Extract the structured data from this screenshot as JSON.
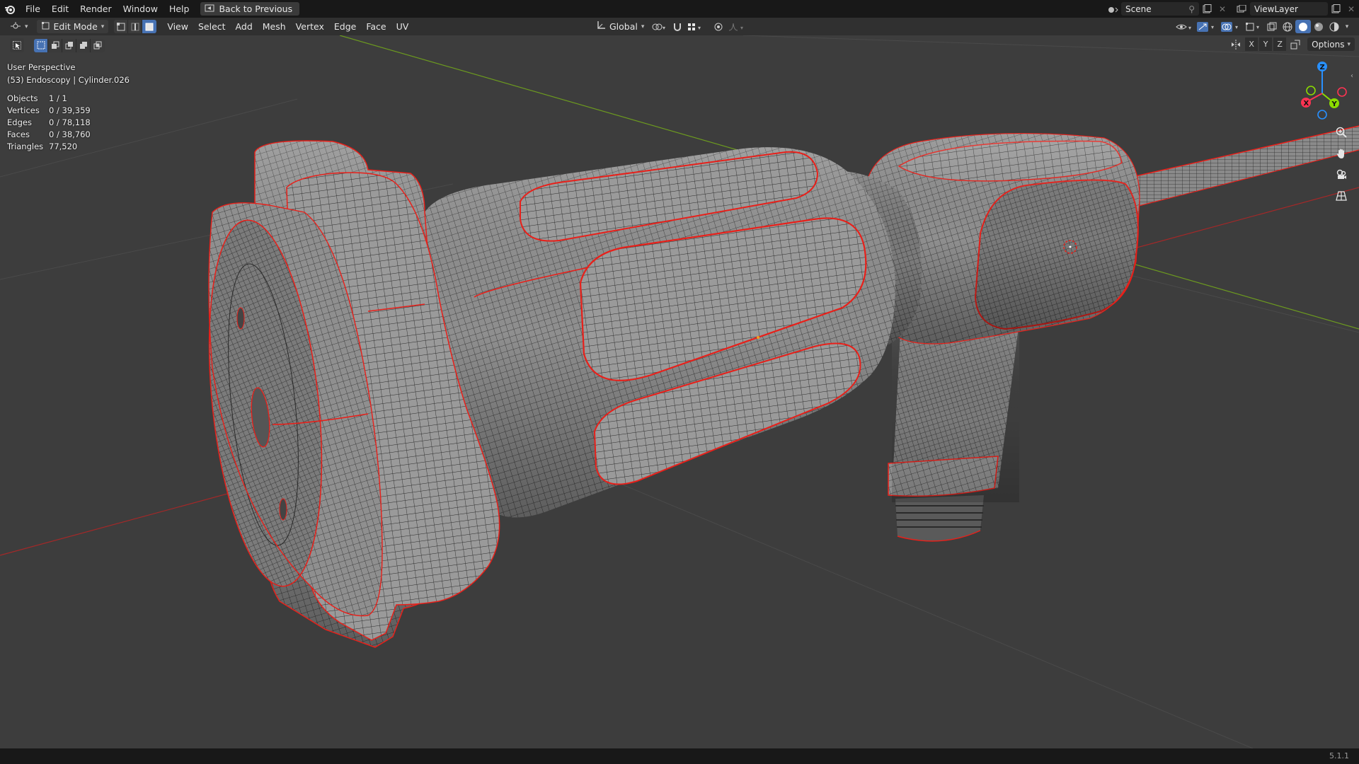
{
  "topbar": {
    "menus": [
      "File",
      "Edit",
      "Render",
      "Window",
      "Help"
    ],
    "back_button": "Back to Previous",
    "scene_label": "Scene",
    "viewlayer_label": "ViewLayer"
  },
  "header": {
    "mode": "Edit Mode",
    "menus": [
      "View",
      "Select",
      "Add",
      "Mesh",
      "Vertex",
      "Edge",
      "Face",
      "UV"
    ],
    "transform_orientation": "Global",
    "select_mode_active": "face"
  },
  "toolrow": {
    "axis_buttons": [
      "X",
      "Y",
      "Z"
    ],
    "options_label": "Options"
  },
  "viewport": {
    "view_name": "User Perspective",
    "object_info": "(53) Endoscopy | Cylinder.026",
    "stats": [
      {
        "label": "Objects",
        "value": "1 / 1"
      },
      {
        "label": "Vertices",
        "value": "0 / 39,359"
      },
      {
        "label": "Edges",
        "value": "0 / 78,118"
      },
      {
        "label": "Faces",
        "value": "0 / 38,760"
      },
      {
        "label": "Triangles",
        "value": "77,520"
      }
    ]
  },
  "gizmo": {
    "axes": [
      "Z",
      "Y",
      "X"
    ],
    "colors": {
      "x": "#ff3352",
      "y": "#8bdc00",
      "z": "#2890ff"
    }
  },
  "statusbar": {
    "version": "5.1.1"
  },
  "colors": {
    "accent": "#4772b3",
    "seam": "#e8201a",
    "background": "#3d3d3d"
  }
}
